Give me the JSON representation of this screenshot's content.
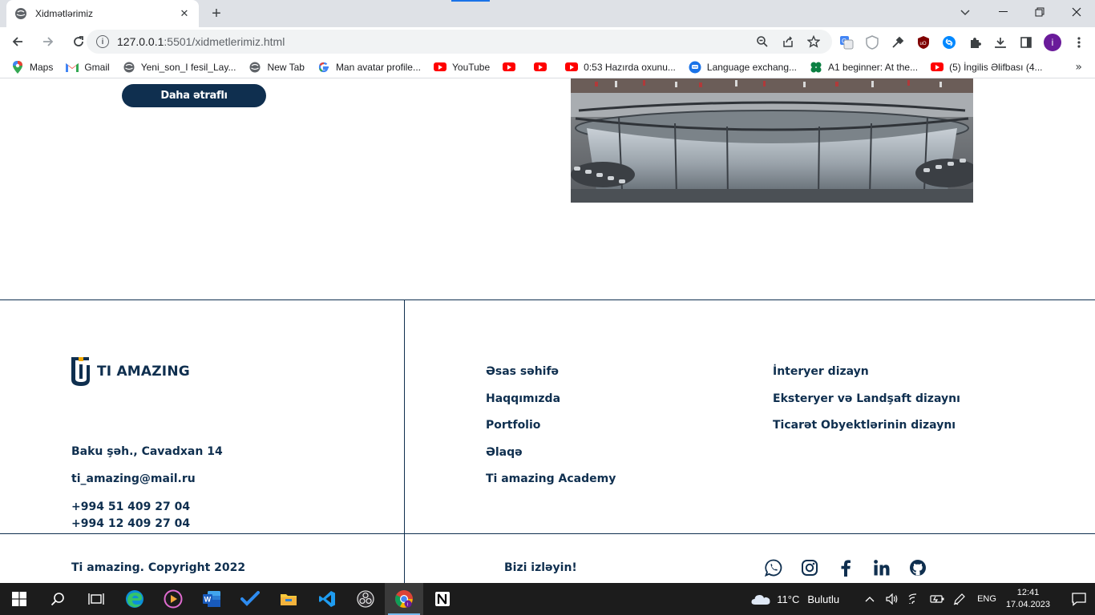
{
  "browser": {
    "tab_title": "Xidmətlərimiz",
    "url_host": "127.0.0.1",
    "url_rest": ":5501/xidmetlerimiz.html",
    "profile_initial": "i",
    "bookmarks": [
      {
        "label": "Maps",
        "icon": "maps-pin-icon"
      },
      {
        "label": "Gmail",
        "icon": "gmail-icon"
      },
      {
        "label": "Yeni_son_I fesil_Lay...",
        "icon": "globe-icon"
      },
      {
        "label": "New Tab",
        "icon": "globe-icon"
      },
      {
        "label": "Man avatar profile...",
        "icon": "google-icon"
      },
      {
        "label": "YouTube",
        "icon": "youtube-icon"
      },
      {
        "label": "",
        "icon": "youtube-icon"
      },
      {
        "label": "",
        "icon": "youtube-icon"
      },
      {
        "label": "0:53 Hazırda oxunu...",
        "icon": "youtube-icon"
      },
      {
        "label": "Language exchang...",
        "icon": "chat-icon"
      },
      {
        "label": "A1 beginner: At the...",
        "icon": "clover-icon"
      },
      {
        "label": "(5) İngilis Əlifbası (4...",
        "icon": "youtube-icon"
      }
    ]
  },
  "page": {
    "more_button": "Daha ətraflı",
    "footer": {
      "logo_text": "TI AMAZING",
      "address": "Baku şəh., Cavadxan 14",
      "email": "ti_amazing@mail.ru",
      "phone1": "+994 51 409 27 04",
      "phone2": "+994 12 409 27 04",
      "nav_main": [
        "Əsas səhifə",
        "Haqqımızda",
        "Portfolio",
        "Əlaqə",
        "Ti amazing Academy"
      ],
      "nav_services": [
        "İnteryer dizayn",
        "Eksteryer və Landşaft dizaynı",
        "Ticarət Obyektlərinin dizaynı"
      ],
      "copyright": "Ti amazing. Copyright 2022",
      "follow_label": "Bizi izləyin!",
      "socials": [
        "whatsapp-icon",
        "instagram-icon",
        "facebook-icon",
        "linkedin-icon",
        "github-icon"
      ]
    },
    "colors": {
      "brand": "#0f2f4f",
      "accent": "#f2a900"
    }
  },
  "taskbar": {
    "weather_temp": "11°C",
    "weather_text": "Bulutlu",
    "language": "ENG",
    "time": "12:41",
    "date": "17.04.2023"
  }
}
